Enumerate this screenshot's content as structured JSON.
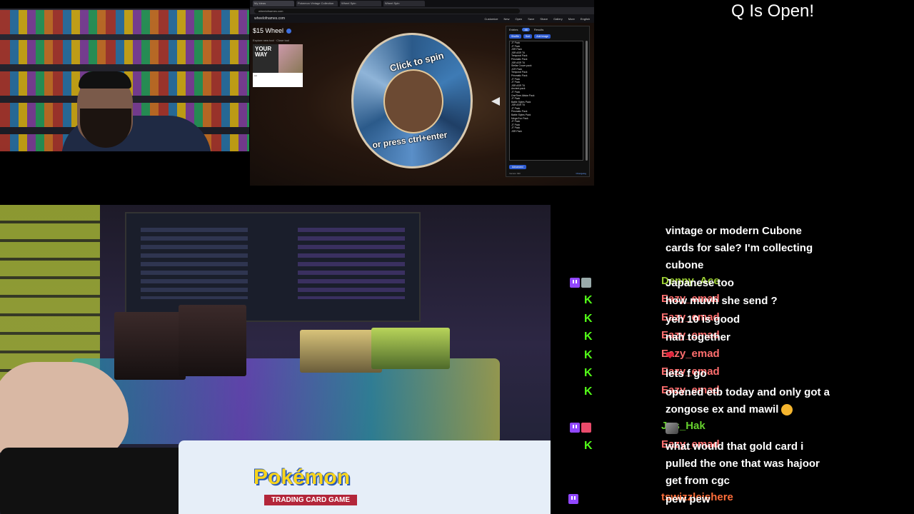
{
  "overlay": {
    "queue_status": "Q Is Open!"
  },
  "browser": {
    "tabs": [
      "My Ideas",
      "Pokemon Vintage Collection",
      "Wheel Spin",
      "Wheel Spin"
    ],
    "url": "wheelofnames.com",
    "site_name": "wheelofnames.com",
    "menu": [
      "Customize",
      "New",
      "Open",
      "Save",
      "Share",
      "Gallery",
      "More",
      "English"
    ],
    "wheel": {
      "title": "$15 Wheel",
      "subtitle": "Explore new tool · Close tool",
      "center_texts": [
        "Click to spin",
        "or press ctrl+enter"
      ],
      "ad_headline": "YOUR WAY",
      "ad_text": "Ad"
    },
    "entries_panel": {
      "tabs": [
        "Entries",
        "Results"
      ],
      "count": "46",
      "tools": [
        "Shuffle",
        "Sort",
        "Add image"
      ],
      "items": [
        "JT Pack",
        "JT Pack",
        "JSR Pack",
        "JSR ASR T6",
        "Temporal Pack",
        "Prismatic Pack",
        "JSR ASR T6",
        "Stellar Crown pack",
        "JCR Pack",
        "Temporal Pack",
        "Prismatic Pack",
        "JT Pack",
        "JT Pack",
        "JSR ASR T6",
        "Ancient pack",
        "JT Pack",
        "OneTime Allstar Pack",
        "JT Pack",
        "Battle Styles Pack",
        "JSR ASR T6",
        "JT Pack",
        "Prismatic Pack",
        "Battle Styles Pack",
        "Mega Evo Pack",
        "JT Pack",
        "JT Pack",
        "JT Pack",
        "JSR Pack"
      ],
      "advanced_label": "Advanced",
      "version": "Version 490",
      "changelog": "Changelog"
    }
  },
  "chat": {
    "messages": [
      {
        "badges": [],
        "user": "",
        "color": "#ffffff",
        "lines": [
          "vintage or modern Cubone",
          "cards for sale? I'm collecting",
          "cubone"
        ]
      },
      {
        "badges": [
          "twitch",
          "gray"
        ],
        "user": "Denny_Ace",
        "color": "#9acd32",
        "lines": [
          "Japanese too"
        ]
      },
      {
        "badges": [
          "k"
        ],
        "user": "Eazy_emad",
        "color": "#ff6e6e",
        "lines": [
          "how muvh she send ?"
        ]
      },
      {
        "badges": [
          "k"
        ],
        "user": "Eazy_emad",
        "color": "#ff6e6e",
        "lines": [
          "yeh 10 is good"
        ]
      },
      {
        "badges": [
          "k"
        ],
        "user": "Eazy_emad",
        "color": "#ff6e6e",
        "lines": [
          "nah together"
        ]
      },
      {
        "badges": [
          "k"
        ],
        "user": "Eazy_emad",
        "color": "#ff6e6e",
        "lines": [
          "heart-emoji"
        ]
      },
      {
        "badges": [
          "k"
        ],
        "user": "Eazy_emad",
        "color": "#ff6e6e",
        "lines": [
          "lets f go"
        ]
      },
      {
        "badges": [
          "k"
        ],
        "user": "Eazy_emad",
        "color": "#ff6e6e",
        "lines": [
          "opened etb today and only got a",
          "zongose ex and mawil"
        ]
      },
      {
        "badges": [
          "twitch",
          "sub"
        ],
        "user": "Jus_Hak",
        "color": "#66d12e",
        "lines": [
          "emote"
        ]
      },
      {
        "badges": [
          "k"
        ],
        "user": "Eazy_emad",
        "color": "#ff6e6e",
        "lines": [
          "what would that gold card i",
          "pulled the one that was hajoor",
          "get from cgc"
        ]
      },
      {
        "badges": [
          "twitch"
        ],
        "user": "tswizzleishere",
        "color": "#ff6e3a",
        "lines": [
          "pew pew"
        ]
      }
    ]
  },
  "tablecam": {
    "playmat_logo": "Pokémon",
    "playmat_sub": "TRADING CARD GAME"
  }
}
